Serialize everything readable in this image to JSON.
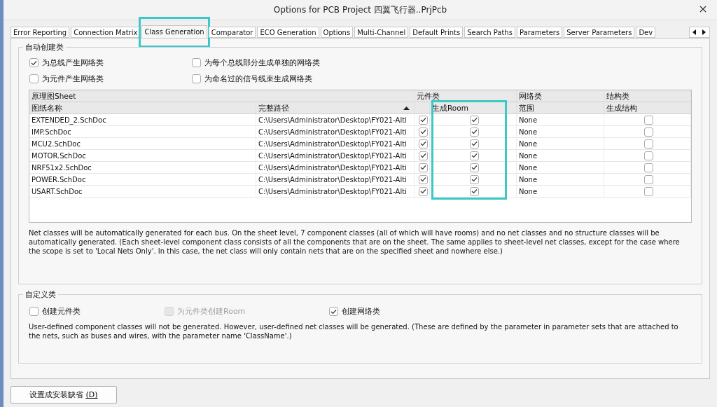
{
  "window": {
    "title": "Options for PCB Project 四翼飞行器..PrjPcb"
  },
  "tabs": [
    {
      "label": "Error Reporting",
      "selected": false,
      "highlighted": false
    },
    {
      "label": "Connection Matrix",
      "selected": false,
      "highlighted": false
    },
    {
      "label": "Class Generation",
      "selected": true,
      "highlighted": true
    },
    {
      "label": "Comparator",
      "selected": false,
      "highlighted": false
    },
    {
      "label": "ECO Generation",
      "selected": false,
      "highlighted": false
    },
    {
      "label": "Options",
      "selected": false,
      "highlighted": false
    },
    {
      "label": "Multi-Channel",
      "selected": false,
      "highlighted": false
    },
    {
      "label": "Default Prints",
      "selected": false,
      "highlighted": false
    },
    {
      "label": "Search Paths",
      "selected": false,
      "highlighted": false
    },
    {
      "label": "Parameters",
      "selected": false,
      "highlighted": false
    },
    {
      "label": "Server Parameters",
      "selected": false,
      "highlighted": false
    },
    {
      "label": "Dev",
      "selected": false,
      "highlighted": false
    }
  ],
  "auto_group": {
    "title": "自动创建类",
    "options": [
      {
        "label": "为总线产生网络类",
        "checked": true
      },
      {
        "label": "为每个总线部分生成单独的网络类",
        "checked": false
      },
      {
        "label": "为元件产生网络类",
        "checked": false
      },
      {
        "label": "为命名过的信号线束生成网络类",
        "checked": false
      }
    ],
    "table": {
      "group_headers": [
        "原理图Sheet",
        "元件类",
        "网络类",
        "结构类"
      ],
      "columns": [
        {
          "label": "图纸名称",
          "sorted": false,
          "highlighted": false
        },
        {
          "label": "完整路径",
          "sorted": true,
          "highlighted": false
        },
        {
          "sorted": false,
          "highlighted": false
        },
        {
          "label": "生成Room",
          "sorted": false,
          "highlighted": true
        },
        {
          "label": "范围",
          "sorted": false,
          "highlighted": false
        },
        {
          "label": "生成结构",
          "sorted": false,
          "highlighted": false
        }
      ],
      "rows": [
        {
          "name": "EXTENDED_2.SchDoc",
          "path": "C:\\Users\\Administrator\\Desktop\\FY021-Alti",
          "component_class": true,
          "room": true,
          "scope": "None",
          "structure": false
        },
        {
          "name": "IMP.SchDoc",
          "path": "C:\\Users\\Administrator\\Desktop\\FY021-Alti",
          "component_class": true,
          "room": true,
          "scope": "None",
          "structure": false
        },
        {
          "name": "MCU2.SchDoc",
          "path": "C:\\Users\\Administrator\\Desktop\\FY021-Alti",
          "component_class": true,
          "room": true,
          "scope": "None",
          "structure": false
        },
        {
          "name": "MOTOR.SchDoc",
          "path": "C:\\Users\\Administrator\\Desktop\\FY021-Alti",
          "component_class": true,
          "room": true,
          "scope": "None",
          "structure": false
        },
        {
          "name": "NRF51x2.SchDoc",
          "path": "C:\\Users\\Administrator\\Desktop\\FY021-Alti",
          "component_class": true,
          "room": true,
          "scope": "None",
          "structure": false
        },
        {
          "name": "POWER.SchDoc",
          "path": "C:\\Users\\Administrator\\Desktop\\FY021-Alti",
          "component_class": true,
          "room": true,
          "scope": "None",
          "structure": false
        },
        {
          "name": "USART.SchDoc",
          "path": "C:\\Users\\Administrator\\Desktop\\FY021-Alti",
          "component_class": true,
          "room": true,
          "scope": "None",
          "structure": false
        }
      ]
    },
    "description": "Net classes will be automatically generated for each bus. On the sheet level, 7 component classes (all of which will have rooms) and no net classes and no structure classes will be automatically generated. (Each sheet-level component class consists of all the components that are on the sheet. The same applies to sheet-level net classes, except for the case where the scope is set to 'Local Nets Only'. In this case, the net class will only contain nets that are on the specified sheet and nowhere else.)"
  },
  "custom_group": {
    "title": "自定义类",
    "options": [
      {
        "label": "创建元件类",
        "checked": false,
        "disabled": false
      },
      {
        "label": "为元件类创建Room",
        "checked": false,
        "disabled": true
      },
      {
        "label": "创建网络类",
        "checked": true,
        "disabled": false
      }
    ],
    "description": "User-defined component classes will not be generated. However, user-defined net classes will be generated. (These are defined by the parameter in parameter sets that are attached to the nets, such as buses and wires, with the parameter name 'ClassName'.)"
  },
  "buttons": [
    {
      "label": "设置成安装缺省",
      "hotkey": "(D)"
    }
  ]
}
